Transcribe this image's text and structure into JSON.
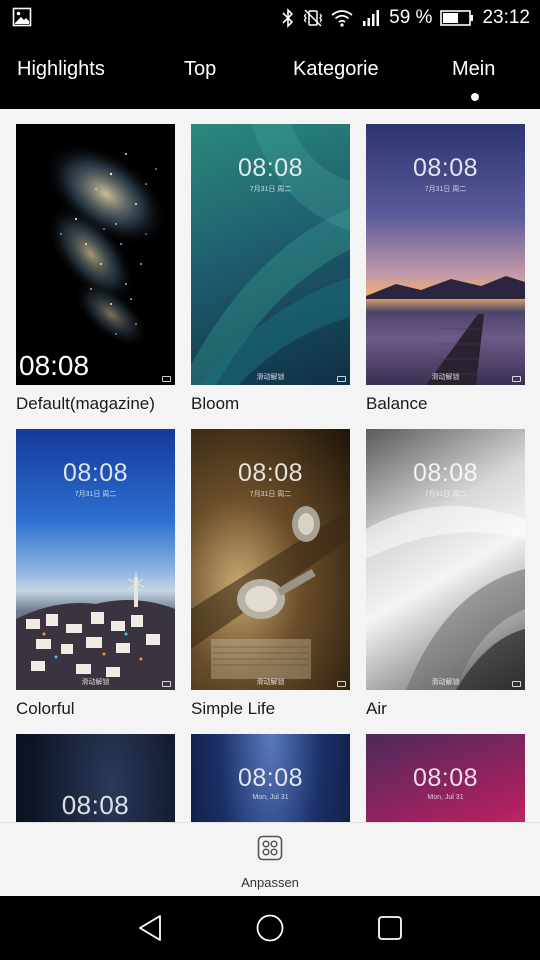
{
  "status_bar": {
    "battery_percent": "59 %",
    "time": "23:12",
    "icons": [
      "gallery-icon",
      "bluetooth-icon",
      "vibrate-icon",
      "wifi-icon",
      "signal-icon",
      "battery-icon"
    ]
  },
  "tabs": [
    {
      "label": "Highlights"
    },
    {
      "label": "Top"
    },
    {
      "label": "Kategorie"
    },
    {
      "label": "Mein",
      "selected": true
    }
  ],
  "themes": [
    {
      "label": "Default(magazine)",
      "time": "08:08"
    },
    {
      "label": "Bloom",
      "time": "08:08",
      "date": "7月31日 周二",
      "unlock": "滑动解锁"
    },
    {
      "label": "Balance",
      "time": "08:08",
      "date": "7月31日 周二",
      "unlock": "滑动解锁"
    },
    {
      "label": "Colorful",
      "time": "08:08",
      "date": "7月31日 周二",
      "unlock": "滑动解锁"
    },
    {
      "label": "Simple Life",
      "time": "08:08",
      "date": "7月31日 周二",
      "unlock": "滑动解锁"
    },
    {
      "label": "Air",
      "time": "08:08",
      "date": "7月31日 周二",
      "unlock": "滑动解锁"
    },
    {
      "label": "",
      "time": "08:08"
    },
    {
      "label": "",
      "time": "08:08",
      "date": "Mon, Jul 31"
    },
    {
      "label": "",
      "time": "08:08",
      "date": "Mon, Jul 31"
    }
  ],
  "action": {
    "customize_label": "Anpassen"
  },
  "nav": {
    "icons": [
      "back-icon",
      "home-icon",
      "recents-icon"
    ]
  }
}
